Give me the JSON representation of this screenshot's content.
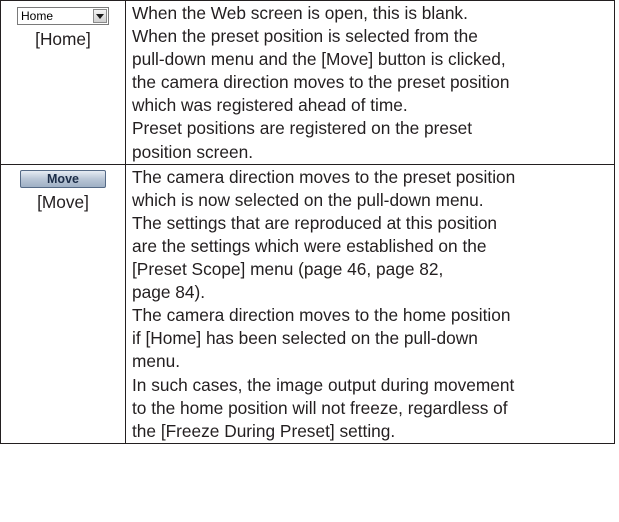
{
  "home_row": {
    "dropdown_value": "Home",
    "caption": "[Home]",
    "lines": [
      "When the Web screen is open, this is blank.",
      "When the preset position is selected from the",
      "pull-down menu and the [Move] button is clicked,",
      "the camera direction moves to the preset position",
      "which was registered ahead of time.",
      "Preset positions are registered on the preset",
      "position screen."
    ]
  },
  "move_row": {
    "button_label": "Move",
    "caption": "[Move]",
    "lines": [
      "The camera direction moves to the preset position",
      "which is now selected on the pull-down menu.",
      "The settings that are reproduced at this position",
      "are the settings which were established on the",
      "[Preset Scope] menu (page 46, page 82,",
      "page 84).",
      "The camera direction moves to the home position",
      "if [Home] has been selected on the pull-down",
      "menu.",
      "In such cases, the image output during movement",
      "to the home position will not freeze, regardless of",
      "the [Freeze During Preset] setting."
    ]
  }
}
